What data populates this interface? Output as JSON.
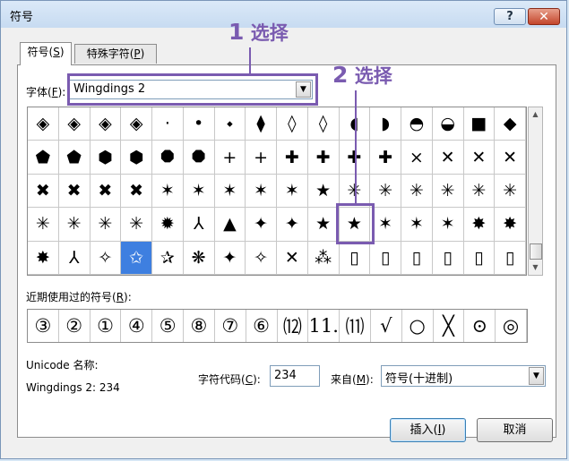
{
  "window": {
    "title": "符号",
    "help": "?",
    "close": "✕"
  },
  "tabs": [
    {
      "label": "符号(",
      "key": "S",
      "suffix": ")"
    },
    {
      "label": "特殊字符(",
      "key": "P",
      "suffix": ")"
    }
  ],
  "font": {
    "label": "字体(",
    "key": "F",
    "suffix": "):",
    "value": "Wingdings 2",
    "arrow": "▼"
  },
  "annotations": {
    "step1_num": "1",
    "step1_text": "选择",
    "step2_num": "2",
    "step2_text": "选择",
    "accent": "#7a5bb0"
  },
  "grid": {
    "selected_index": 67,
    "selection_color": "#3e7fe0",
    "symbols": [
      "◈",
      "◈",
      "◈",
      "◈",
      "·",
      "•",
      "⬩",
      "⧫",
      "◊",
      "◊",
      "◖",
      "◗",
      "◓",
      "◒",
      "■",
      "◆",
      "⬟",
      "⬟",
      "⬢",
      "⬢",
      "⯃",
      "⯃",
      "+",
      "+",
      "✚",
      "✚",
      "✚",
      "✚",
      "×",
      "✕",
      "✕",
      "✕",
      "✖",
      "✖",
      "✖",
      "✖",
      "✶",
      "✶",
      "✶",
      "✶",
      "✶",
      "★",
      "✳",
      "✳",
      "✳",
      "✳",
      "✳",
      "✳",
      "✳",
      "✳",
      "✳",
      "✳",
      "✹",
      "⅄",
      "▲",
      "✦",
      "✦",
      "★",
      "★",
      "✶",
      "✶",
      "✶",
      "✸",
      "✸",
      "✸",
      "⅄",
      "✧",
      "✩",
      "✰",
      "❋",
      "✦",
      "✧",
      "✕",
      "⁂",
      "▯",
      "▯",
      "▯",
      "▯",
      "▯",
      "▯"
    ],
    "scroll_up": "▲",
    "scroll_down": "▼"
  },
  "recent": {
    "label": "近期使用过的符号(",
    "key": "R",
    "suffix": "):",
    "symbols": [
      "③",
      "②",
      "①",
      "④",
      "⑤",
      "⑧",
      "⑦",
      "⑥",
      "⑿",
      "11.",
      "⑾",
      "√",
      "○",
      "╳",
      "⊙",
      "◎"
    ]
  },
  "unicode": {
    "label": "Unicode 名称:",
    "value": "Wingdings 2: 234"
  },
  "char_code": {
    "label": "字符代码(",
    "key": "C",
    "suffix": "):",
    "value": "234"
  },
  "from": {
    "label": "来自(",
    "key": "M",
    "suffix": "):",
    "value": "符号(十进制)",
    "arrow": "▼"
  },
  "buttons": {
    "insert": {
      "label": "插入(",
      "key": "I",
      "suffix": ")"
    },
    "cancel": "取消"
  }
}
